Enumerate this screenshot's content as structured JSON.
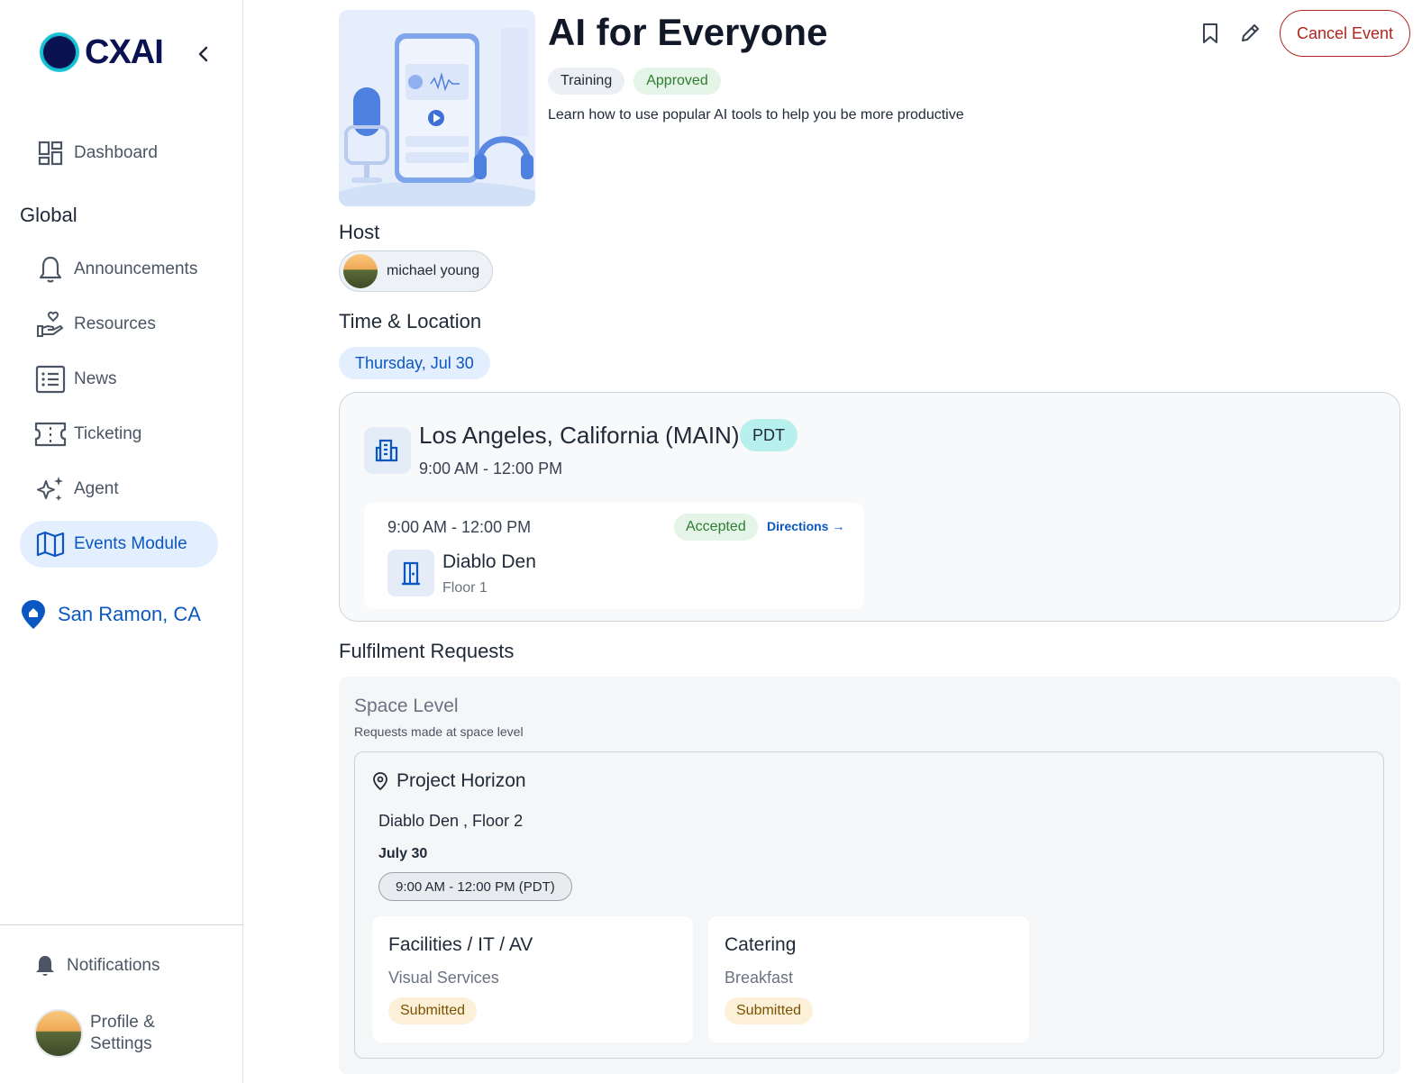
{
  "sidebar": {
    "logo_text": "CXAI",
    "collapse_icon": "chevron-left-icon",
    "dashboard": {
      "label": "Dashboard",
      "icon": "dashboard-icon"
    },
    "section_heading": "Global",
    "items": [
      {
        "label": "Announcements",
        "icon": "bell-icon"
      },
      {
        "label": "Resources",
        "icon": "hand-heart-icon"
      },
      {
        "label": "News",
        "icon": "list-icon"
      },
      {
        "label": "Ticketing",
        "icon": "ticket-icon"
      },
      {
        "label": "Agent",
        "icon": "sparkle-icon"
      },
      {
        "label": "Events Module",
        "icon": "map-icon",
        "active": true
      }
    ],
    "location": {
      "label": "San Ramon, CA",
      "icon": "location-pin-icon"
    },
    "notifications": {
      "label": "Notifications",
      "icon": "bell-filled-icon"
    },
    "profile": {
      "label_line1": "Profile &",
      "label_line2": "Settings"
    }
  },
  "event": {
    "title": "AI for Everyone",
    "tags": [
      "Training",
      "Approved"
    ],
    "description": "Learn how to use popular AI tools to help you be more productive",
    "actions": {
      "bookmark_icon": "bookmark-icon",
      "edit_icon": "pencil-icon",
      "cancel_label": "Cancel Event"
    }
  },
  "host": {
    "heading": "Host",
    "name": "michael young"
  },
  "time_location": {
    "heading": "Time & Location",
    "date": "Thursday, Jul 30",
    "location_name": "Los Angeles, California (MAIN)",
    "timezone": "PDT",
    "time": "9:00 AM - 12:00 PM",
    "room": {
      "time": "9:00 AM - 12:00 PM",
      "status": "Accepted",
      "directions": "Directions",
      "name": "Diablo Den",
      "floor": "Floor 1"
    }
  },
  "fulfilment": {
    "heading": "Fulfilment Requests",
    "space_level": "Space Level",
    "space_level_sub": "Requests made at space level",
    "project": {
      "name": "Project Horizon",
      "room": "Diablo Den , Floor 2",
      "date": "July 30",
      "time": "9:00 AM - 12:00 PM  (PDT)",
      "requests": [
        {
          "title": "Facilities / IT / AV",
          "subtitle": "Visual Services",
          "status": "Submitted"
        },
        {
          "title": "Catering",
          "subtitle": "Breakfast",
          "status": "Submitted"
        }
      ]
    }
  },
  "colors": {
    "accent": "#0b57c2",
    "active_bg": "#e3efff",
    "danger": "#b3261e",
    "success": "#2e7d32",
    "warning_bg": "#fcf0d9"
  }
}
